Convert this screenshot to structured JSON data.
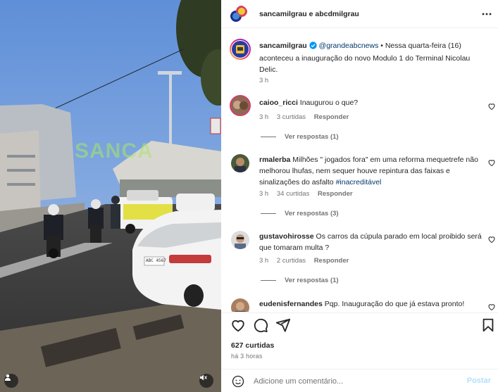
{
  "header": {
    "author_1": "sancamilgrau",
    "connector": " e ",
    "author_2": "abcdmilgrau",
    "more_icon": "more-horizontal-icon"
  },
  "caption": {
    "username": "sancamilgrau",
    "verified_icon": "verified-badge-icon",
    "mention": "@grandeabcnews",
    "text": " • Nessa quarta-feira (16) aconteceu a inauguração do novo Modulo 1 do Terminal Nicolau Delic.",
    "time": "3 h"
  },
  "comments": [
    {
      "username": "caioo_ricci",
      "text": "Inaugurou o que?",
      "time": "3 h",
      "likes": "3 curtidas",
      "reply_label": "Responder",
      "view_replies": "Ver respostas (1)"
    },
    {
      "username": "rmalerba",
      "text": "Milhões \" jogados fora\" em uma reforma mequetrefe não melhorou lhufas, nem sequer houve repintura das faixas e sinalizações do asfalto ",
      "hashtag": "#inacreditável",
      "time": "3 h",
      "likes": "34 curtidas",
      "reply_label": "Responder",
      "view_replies": "Ver respostas (3)"
    },
    {
      "username": "gustavohirosse",
      "text": "Os carros da cúpula parado em local proibido será que tomaram multa ?",
      "time": "3 h",
      "likes": "2 curtidas",
      "reply_label": "Responder",
      "view_replies": "Ver respostas (1)"
    },
    {
      "username": "eudenisfernandes",
      "text": "Pqp. Inauguração do que já estava pronto!"
    }
  ],
  "actions": {
    "like_icon": "heart-icon",
    "comment_icon": "comment-icon",
    "share_icon": "send-icon",
    "save_icon": "bookmark-icon"
  },
  "likes_count": "627 curtidas",
  "time_ago": "há 3 horas",
  "add_comment": {
    "emoji_icon": "emoji-icon",
    "placeholder": "Adicione um comentário...",
    "post_label": "Postar"
  },
  "media": {
    "watermark": "SANCA",
    "plate": "ABC 4567",
    "user_tag_icon": "user-tag-icon",
    "mute_icon": "muted-speaker-icon"
  },
  "colors": {
    "link": "#00376b",
    "muted": "#737373",
    "post_disabled": "#b2dffc"
  }
}
